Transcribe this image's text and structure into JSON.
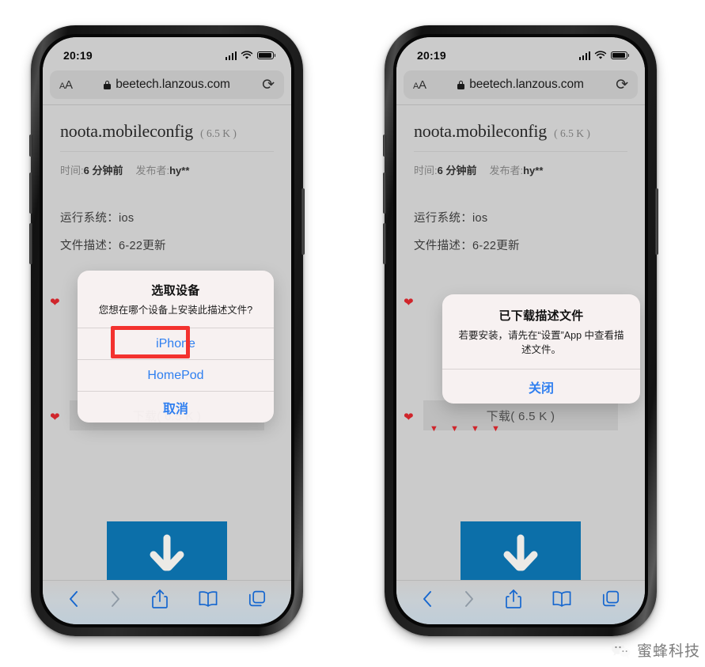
{
  "status_bar": {
    "time": "20:19",
    "signal": "cellular-bars-icon",
    "wifi": "wifi-icon",
    "battery": "battery-icon"
  },
  "browser": {
    "aa_label": "AA",
    "lock": "lock-icon",
    "url": "beetech.lanzous.com",
    "reload": "⟳"
  },
  "page": {
    "file_name": "noota.mobileconfig",
    "file_size": "( 6.5 K )",
    "time_label": "时间:",
    "time_value": "6 分钟前",
    "publisher_label": "发布者:",
    "publisher_value": "hy**",
    "os_label": "运行系统：",
    "os_value": "ios",
    "desc_label": "文件描述：",
    "desc_value": "6-22更新",
    "download_button": "下载( 6.5 K )",
    "banner_icon": "download-arrow-icon"
  },
  "toolbar": {
    "back": "chevron-left-icon",
    "forward": "chevron-right-icon",
    "share": "share-icon",
    "bookmarks": "book-icon",
    "tabs": "tabs-icon"
  },
  "left_phone": {
    "dialog": {
      "title": "选取设备",
      "message": "您想在哪个设备上安装此描述文件?",
      "options": [
        "iPhone",
        "HomePod"
      ],
      "cancel": "取消",
      "highlighted_option": "iPhone",
      "highlight_color": "#f3322f"
    }
  },
  "right_phone": {
    "dialog": {
      "title": "已下载描述文件",
      "message": "若要安装，请先在“设置”App 中查看描述文件。",
      "close": "关闭"
    }
  },
  "watermark": {
    "icon": "wechat-icon",
    "text": "蜜蜂科技"
  }
}
